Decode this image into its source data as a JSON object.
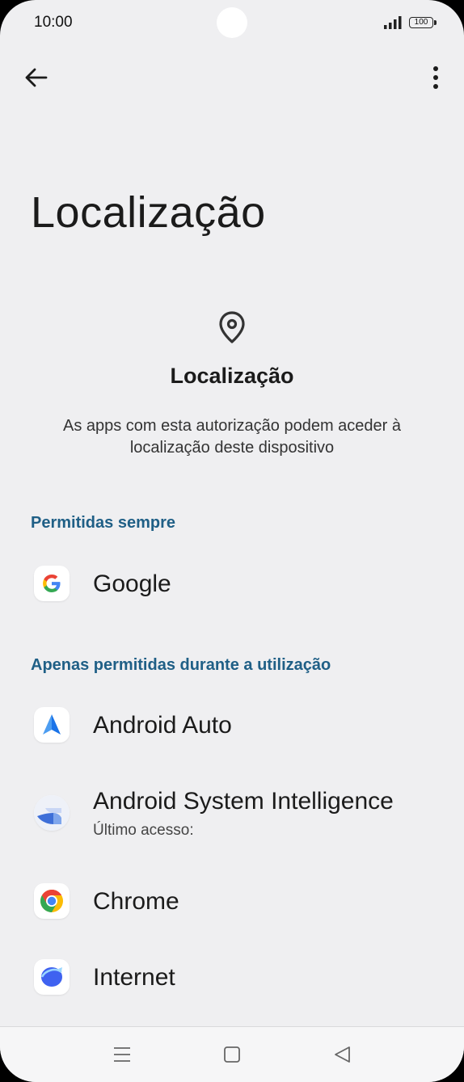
{
  "status_bar": {
    "time": "10:00",
    "battery": "100"
  },
  "toolbar": {
    "back_icon": "arrow-left-icon",
    "more_icon": "more-vert-icon"
  },
  "page": {
    "title": "Localização"
  },
  "header": {
    "icon": "location-pin-icon",
    "title": "Localização",
    "description": "As apps com esta autorização podem aceder à localização deste dispositivo"
  },
  "sections": [
    {
      "title": "Permitidas sempre",
      "apps": [
        {
          "name": "Google",
          "icon": "google-icon"
        }
      ]
    },
    {
      "title": "Apenas permitidas durante a utilização",
      "apps": [
        {
          "name": "Android Auto",
          "icon": "android-auto-icon"
        },
        {
          "name": "Android System Intelligence",
          "subtitle": "Último acesso:",
          "icon": "android-system-intelligence-icon"
        },
        {
          "name": "Chrome",
          "icon": "chrome-icon"
        },
        {
          "name": "Internet",
          "icon": "internet-icon"
        }
      ]
    }
  ],
  "nav_bar": {
    "recents_icon": "menu-lines-icon",
    "home_icon": "square-home-icon",
    "back_icon": "triangle-back-icon"
  },
  "colors": {
    "background": "#efeff1",
    "category_text": "#1f5f86",
    "text_primary": "#1b1b1b"
  }
}
